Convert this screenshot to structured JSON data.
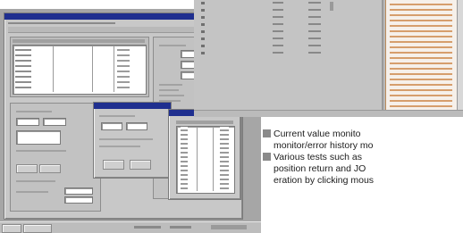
{
  "caption": {
    "line1": "Current value monito",
    "line2": "monitor/error history mo",
    "line3": "Various tests such as",
    "line4": "position return and JO",
    "line5": "eration by clicking mous"
  },
  "colors": {
    "desktop_bg": "#a6a6a6",
    "window_bg": "#c8c8c8",
    "titlebar": "#1f2f8f",
    "history_text": "#c8863c",
    "history_sidebar": "#ba8a5a",
    "bullet": "#8a8a8a"
  },
  "icons": [
    "bullet-square-icon",
    "bullet-square-icon"
  ]
}
